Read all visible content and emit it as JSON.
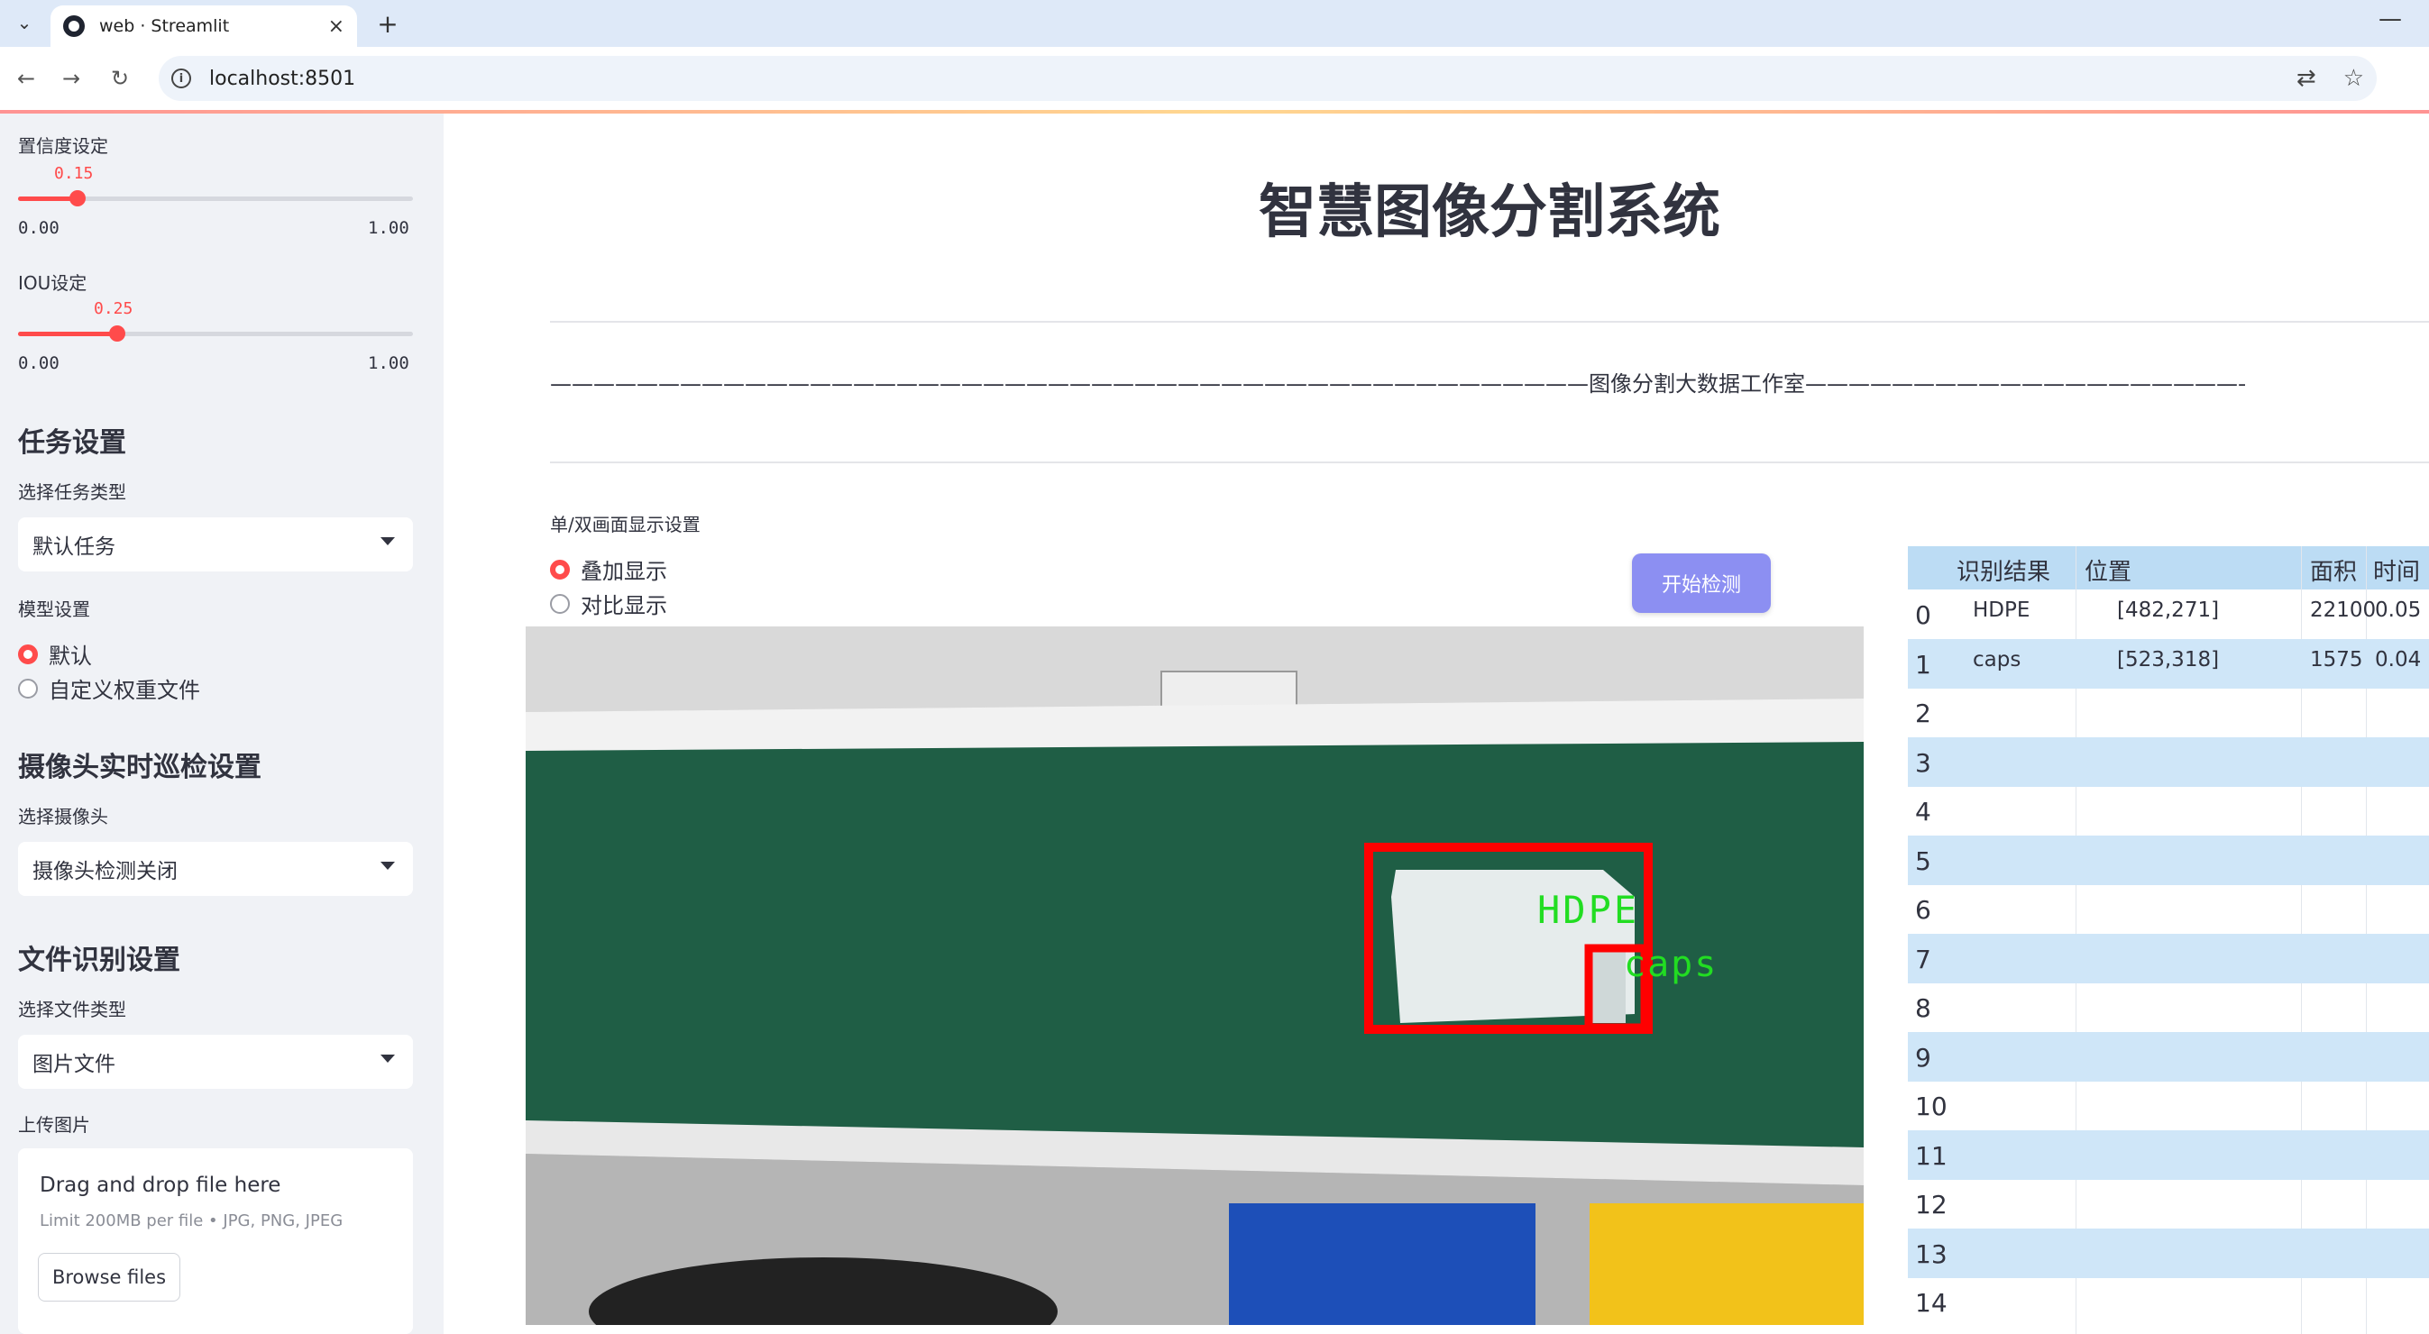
{
  "browser": {
    "tab_title": "web · Streamlit",
    "url": "localhost:8501",
    "close_glyph": "×",
    "new_tab_glyph": "+",
    "minimize_glyph": "—"
  },
  "sidebar": {
    "confidence": {
      "label": "置信度设定",
      "value": "0.15",
      "value_frac": 0.15,
      "min": "0.00",
      "max": "1.00"
    },
    "iou": {
      "label": "IOU设定",
      "value": "0.25",
      "value_frac": 0.25,
      "min": "0.00",
      "max": "1.00"
    },
    "task_heading": "任务设置",
    "task_type_label": "选择任务类型",
    "task_type_value": "默认任务",
    "model_label": "模型设置",
    "model_options": [
      "默认",
      "自定义权重文件"
    ],
    "camera_heading": "摄像头实时巡检设置",
    "camera_label": "选择摄像头",
    "camera_value": "摄像头检测关闭",
    "file_heading": "文件识别设置",
    "file_type_label": "选择文件类型",
    "file_type_value": "图片文件",
    "upload_label": "上传图片",
    "upload_drag": "Drag and drop file here",
    "upload_limit": "Limit 200MB per file • JPG, PNG, JPEG",
    "browse_label": "Browse files"
  },
  "main": {
    "title": "智慧图像分割系统",
    "studio_line": "————————————————————————————————————————————————图像分割大数据工作室————————————————————————————————————————————————————————————",
    "display_mode_label": "单/双画面显示设置",
    "display_options": [
      "叠加显示",
      "对比显示"
    ],
    "start_button": "开始检测",
    "detections": [
      {
        "label": "HDPE",
        "color": "#ff0000",
        "text_color": "#22dd22"
      },
      {
        "label": "caps",
        "color": "#ff0000",
        "text_color": "#22dd22"
      }
    ]
  },
  "results_table": {
    "columns": [
      "识别结果",
      "位置",
      "面积",
      "时间"
    ],
    "rows": [
      {
        "idx": "0",
        "label": "HDPE",
        "pos": "[482,271]",
        "area": "22100",
        "time": "0.05"
      },
      {
        "idx": "1",
        "label": "caps",
        "pos": "[523,318]",
        "area": "1575",
        "time": "0.04"
      },
      {
        "idx": "2",
        "label": "",
        "pos": "",
        "area": "",
        "time": ""
      },
      {
        "idx": "3",
        "label": "",
        "pos": "",
        "area": "",
        "time": ""
      },
      {
        "idx": "4",
        "label": "",
        "pos": "",
        "area": "",
        "time": ""
      },
      {
        "idx": "5",
        "label": "",
        "pos": "",
        "area": "",
        "time": ""
      },
      {
        "idx": "6",
        "label": "",
        "pos": "",
        "area": "",
        "time": ""
      },
      {
        "idx": "7",
        "label": "",
        "pos": "",
        "area": "",
        "time": ""
      },
      {
        "idx": "8",
        "label": "",
        "pos": "",
        "area": "",
        "time": ""
      },
      {
        "idx": "9",
        "label": "",
        "pos": "",
        "area": "",
        "time": ""
      },
      {
        "idx": "10",
        "label": "",
        "pos": "",
        "area": "",
        "time": ""
      },
      {
        "idx": "11",
        "label": "",
        "pos": "",
        "area": "",
        "time": ""
      },
      {
        "idx": "12",
        "label": "",
        "pos": "",
        "area": "",
        "time": ""
      },
      {
        "idx": "13",
        "label": "",
        "pos": "",
        "area": "",
        "time": ""
      },
      {
        "idx": "14",
        "label": "",
        "pos": "",
        "area": "",
        "time": ""
      }
    ]
  }
}
